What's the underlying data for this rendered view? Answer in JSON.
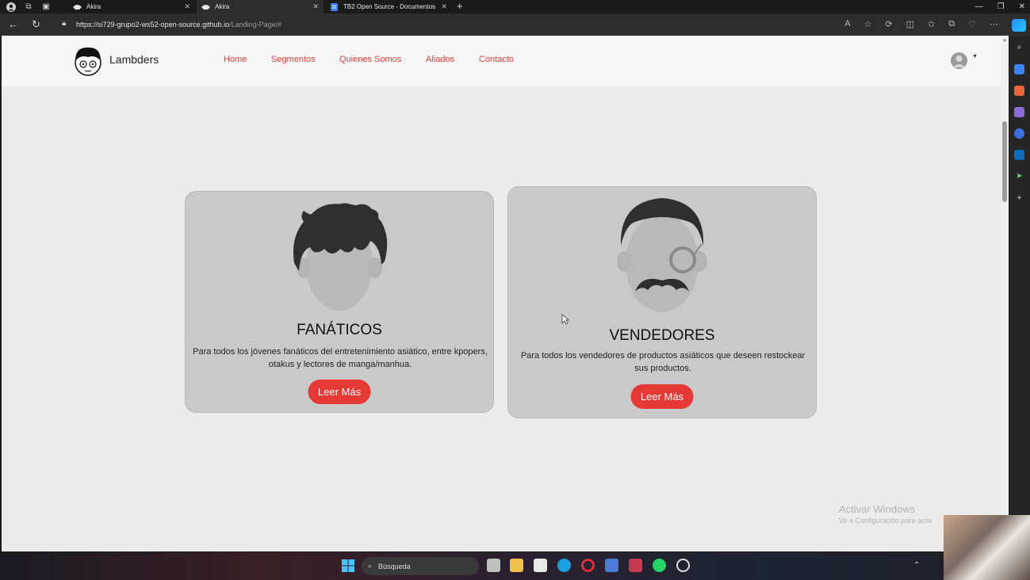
{
  "browser": {
    "tabs": [
      {
        "title": "Akira",
        "active": false
      },
      {
        "title": "Akira",
        "active": true
      },
      {
        "title": "TB2 Open Source - Documentos",
        "active": false
      }
    ],
    "url_host": "https://si729-grupo2-ws52-open-source.github.io",
    "url_path": "/Landing-Page/#"
  },
  "site": {
    "brand": "Lambders",
    "nav": [
      "Home",
      "Segmentos",
      "Quienes Somos",
      "Aliados",
      "Contacto"
    ],
    "accent_color": "#e53935"
  },
  "cards": [
    {
      "title": "FANÁTICOS",
      "text": "Para todos los jóvenes fanáticos del entretenimiento asiático, entre kpopers, otakus y lectores de manga/manhua.",
      "button": "Leer Más",
      "icon": "young-person-avatar-icon"
    },
    {
      "title": "VENDEDORES",
      "text": "Para todos los vendedores de productos asiáticos que deseen restockear sus productos.",
      "button": "Leer Más",
      "icon": "monocle-mustache-avatar-icon"
    }
  ],
  "watermark": {
    "title": "Activar Windows",
    "subtitle": "Ve a Configuración para activ"
  },
  "taskbar": {
    "search_label": "Búsqueda"
  }
}
